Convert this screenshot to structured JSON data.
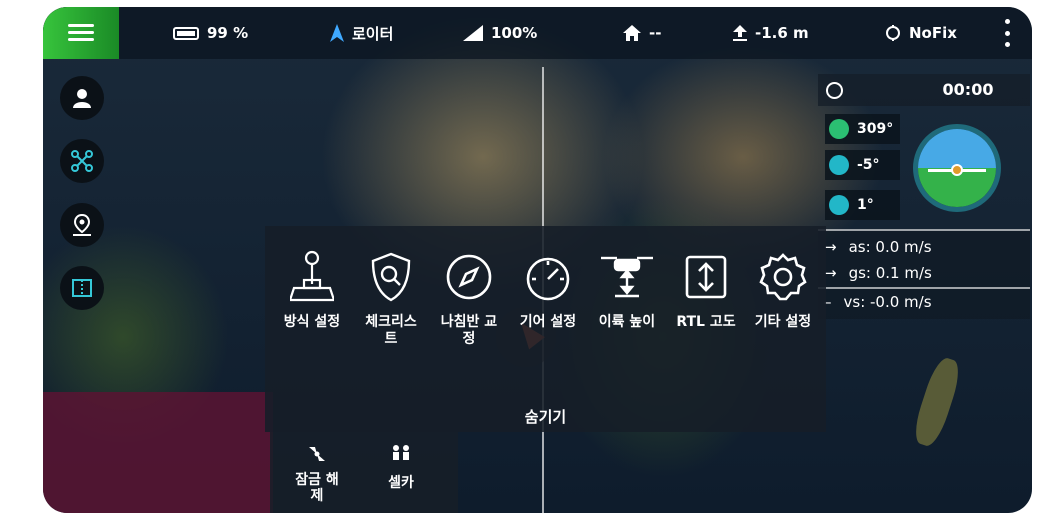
{
  "topbar": {
    "battery": "99 %",
    "mode": "로이터",
    "signal": "100%",
    "home_distance": "--",
    "altitude": "-1.6 m",
    "gps": "NoFix"
  },
  "timer": "00:00",
  "attitude": {
    "yaw": "309°",
    "pitch": "-5°",
    "roll": "1°"
  },
  "speeds": {
    "as": "as: 0.0 m/s",
    "gs": "gs: 0.1 m/s",
    "vs": "vs: -0.0 m/s"
  },
  "menu": {
    "items": [
      {
        "label": "방식 설정",
        "icon": "joystick-icon"
      },
      {
        "label": "체크리스\n트",
        "icon": "shield-search-icon"
      },
      {
        "label": "나침반 교\n정",
        "icon": "compass-icon"
      },
      {
        "label": "기어 설정",
        "icon": "gauge-icon"
      },
      {
        "label": "이륙 높이",
        "icon": "drone-height-icon"
      },
      {
        "label": "RTL 고도",
        "icon": "vertical-arrows-icon"
      },
      {
        "label": "기타 설정",
        "icon": "gear-icon"
      }
    ],
    "collapse_label": "숨기기"
  },
  "bottom_actions": {
    "unlock": "잠금 해\n제",
    "selfie": "셀카"
  },
  "colors": {
    "accent_green": "#37c43c",
    "attitude_cyan": "#22b7c8",
    "vehicle_orange": "#e8623a"
  }
}
